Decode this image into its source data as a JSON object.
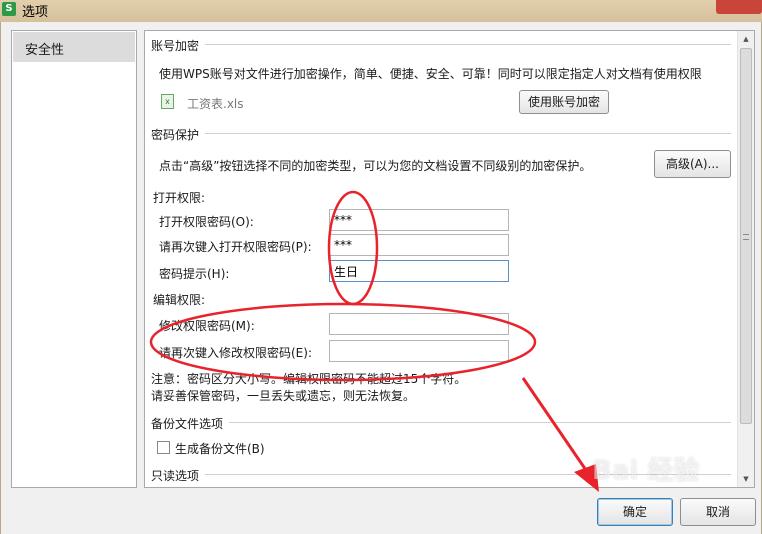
{
  "window": {
    "title": "选项"
  },
  "sidebar": {
    "items": [
      {
        "label": "安全性"
      }
    ]
  },
  "account": {
    "section_title": "账号加密",
    "description": "使用WPS账号对文件进行加密操作，简单、便捷、安全、可靠！同时可以限定指定人对文档有使用权限",
    "file_name": "工资表.xls",
    "button_label": "使用账号加密"
  },
  "password": {
    "section_title": "密码保护",
    "description": "点击“高级”按钮选择不同的加密类型，可以为您的文档设置不同级别的加密保护。",
    "advanced_label": "高级(A)...",
    "open_group": "打开权限:",
    "open_password_label": "打开权限密码(O):",
    "open_password_value": "***",
    "open_confirm_label": "请再次键入打开权限密码(P):",
    "open_confirm_value": "***",
    "hint_label": "密码提示(H):",
    "hint_value": "生日",
    "edit_group": "编辑权限:",
    "edit_password_label": "修改权限密码(M):",
    "edit_password_value": "",
    "edit_confirm_label": "请再次键入修改权限密码(E):",
    "edit_confirm_value": "",
    "note_line1": "注意：密码区分大小写。编辑权限密码不能超过15个字符。",
    "note_line2": "请妥善保管密码，一旦丢失或遗忘，则无法恢复。"
  },
  "backup": {
    "section_title": "备份文件选项",
    "checkbox_label": "生成备份文件(B)",
    "checked": false
  },
  "readonly": {
    "section_title": "只读选项"
  },
  "footer": {
    "ok_label": "确定",
    "cancel_label": "取消"
  },
  "watermark": {
    "text": "Bai 经验"
  },
  "colors": {
    "annotation": "#e8232b",
    "accent": "#5a8fc9"
  }
}
